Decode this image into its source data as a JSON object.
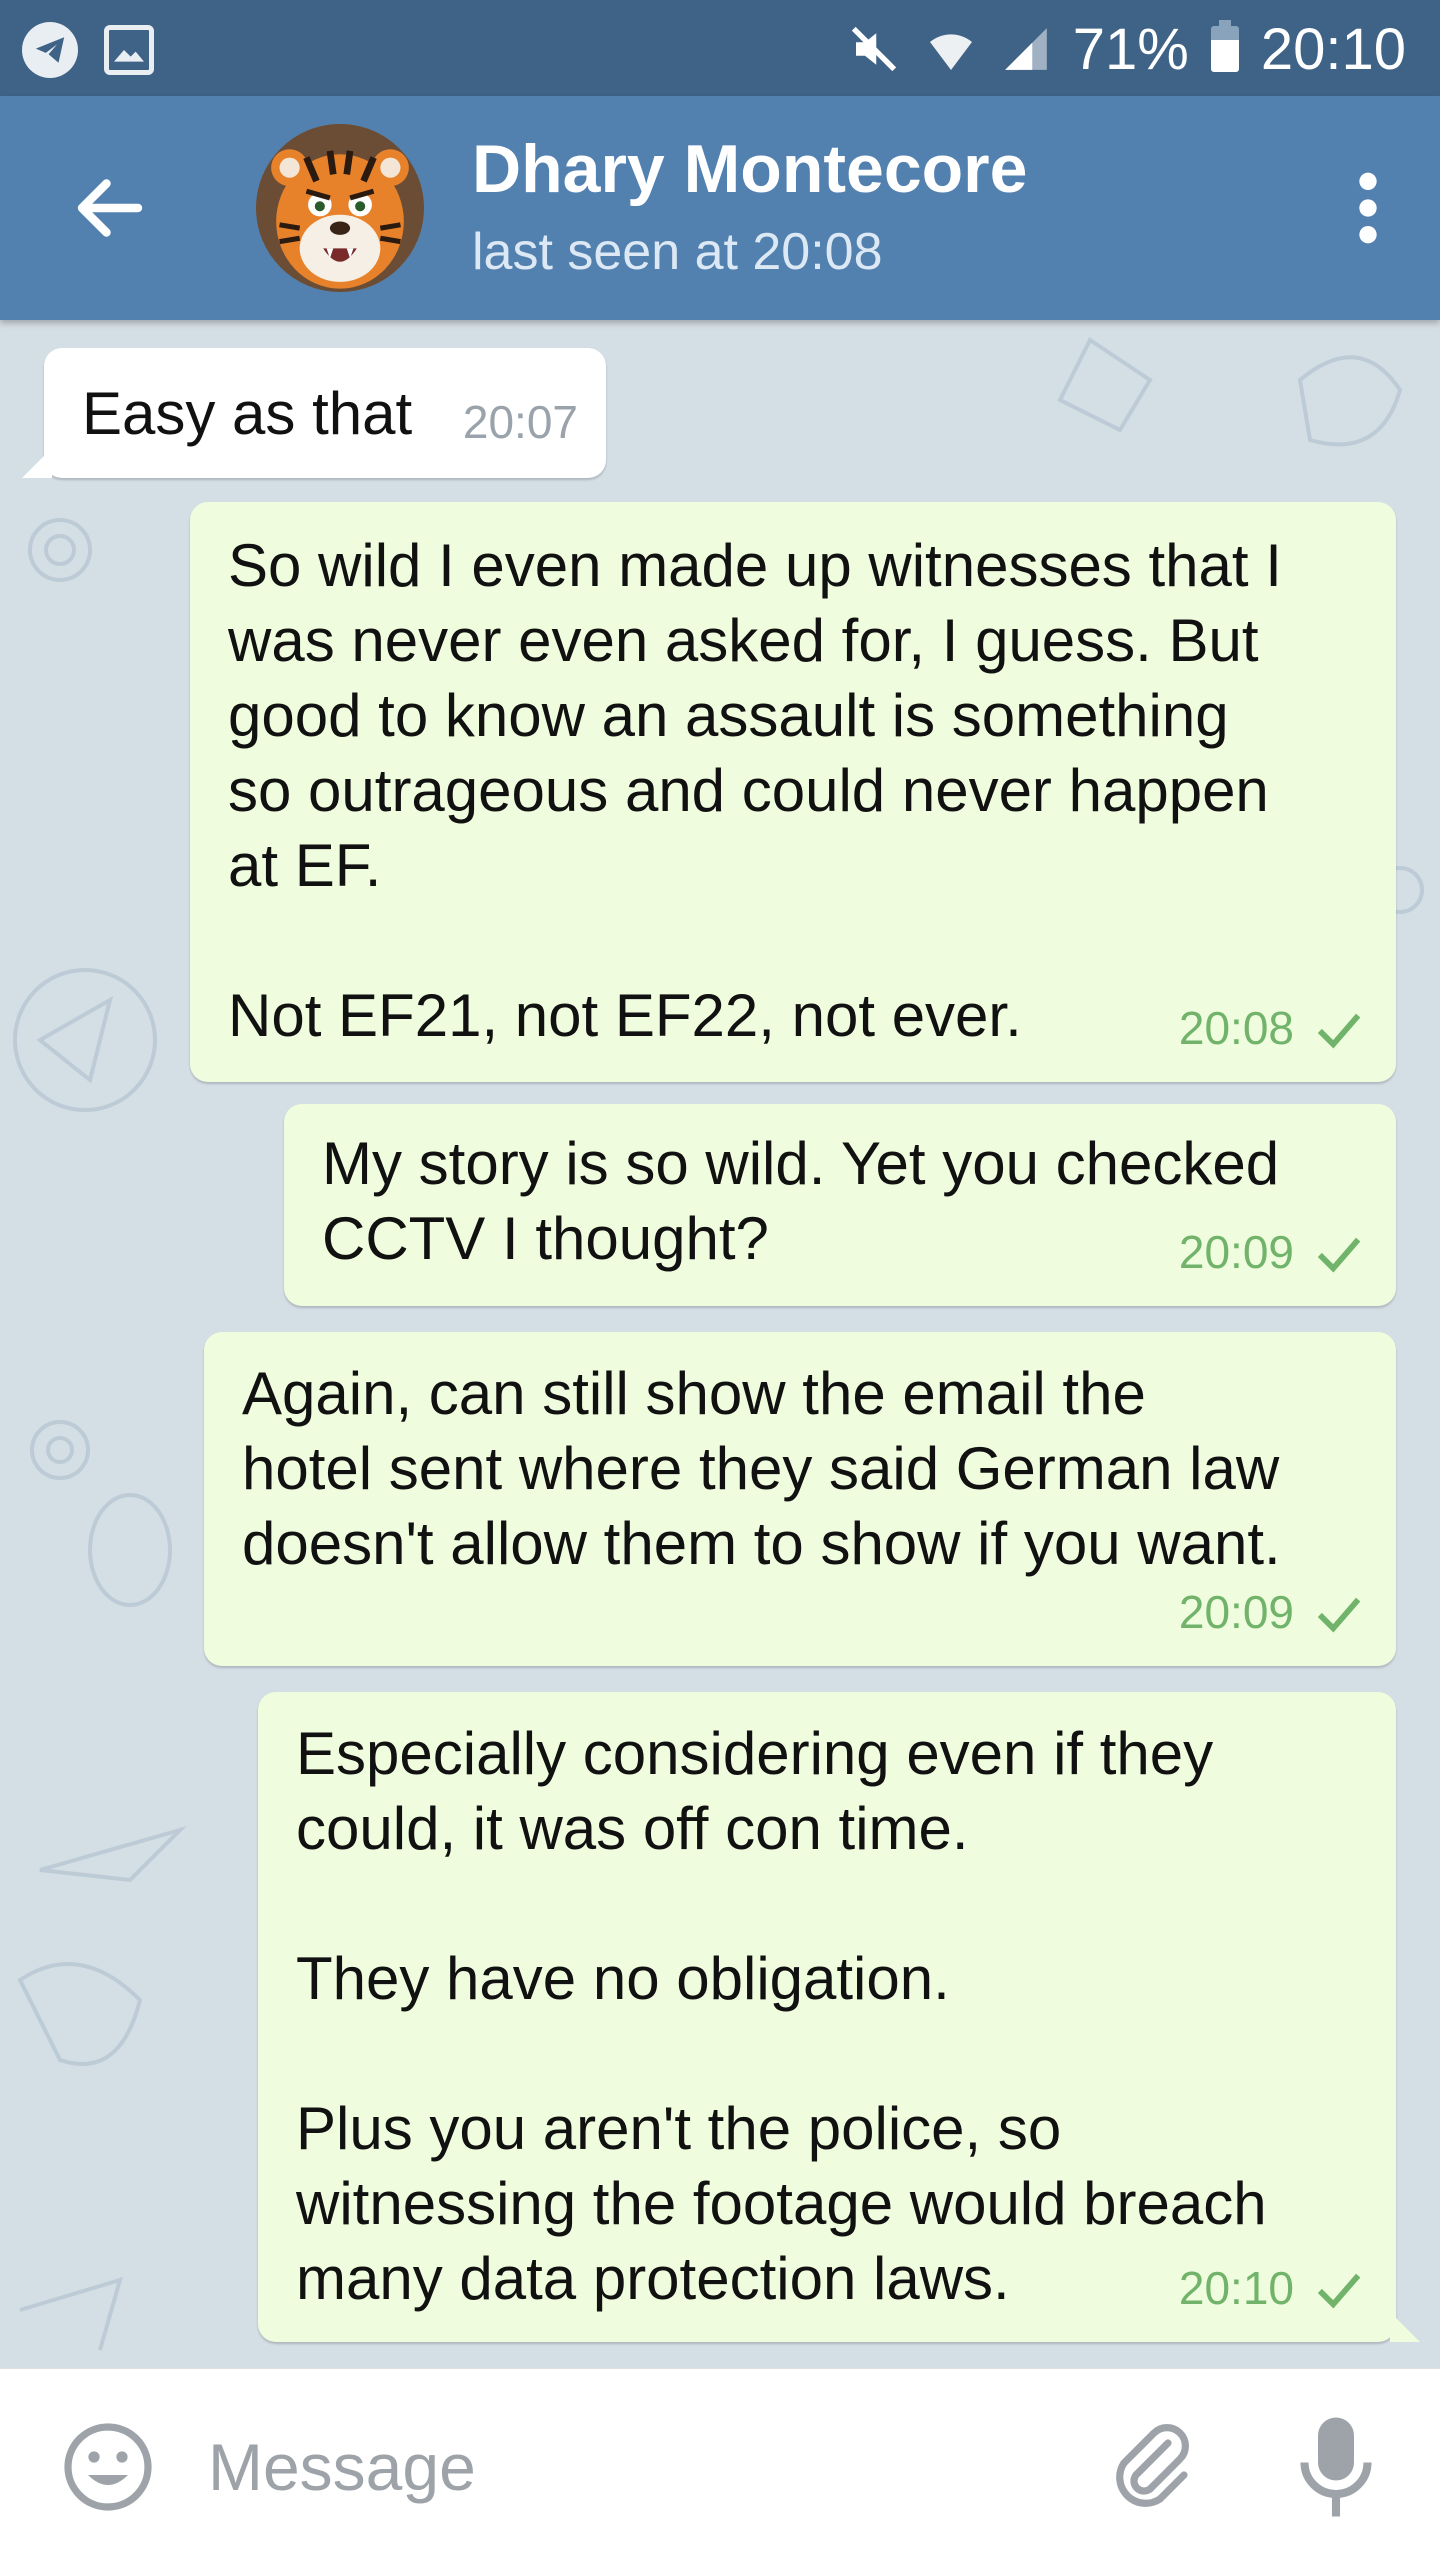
{
  "status_bar": {
    "battery": "71%",
    "time": "20:10",
    "icons": [
      "telegram-icon",
      "image-icon",
      "mute-icon",
      "wifi-icon",
      "signal-icon",
      "battery-icon"
    ]
  },
  "header": {
    "contact_name": "Dhary Montecore",
    "last_seen": "last seen at 20:08",
    "icons": [
      "back-arrow-icon",
      "tiger-avatar",
      "more-vert-icon"
    ]
  },
  "messages": [
    {
      "direction": "incoming",
      "text": "Easy as that",
      "time": "20:07"
    },
    {
      "direction": "outgoing",
      "text": "So wild I even made up witnesses that I\nwas never even asked for, I guess. But\ngood to know an assault is something\nso outrageous and could never happen\nat EF.\n\nNot EF21, not EF22, not ever.",
      "time": "20:08",
      "status": "sent"
    },
    {
      "direction": "outgoing",
      "text": "My story is so wild. Yet you checked\nCCTV I thought?",
      "time": "20:09",
      "status": "sent"
    },
    {
      "direction": "outgoing",
      "text": "Again, can still show the email the\nhotel sent where they said German law\ndoesn't allow them to show if you want.",
      "time": "20:09",
      "status": "sent"
    },
    {
      "direction": "outgoing",
      "text": "Especially considering even if they\ncould, it was off con time.\n\nThey have no obligation.\n\nPlus you aren't the police, so\nwitnessing the footage would breach\nmany data protection laws.",
      "time": "20:10",
      "status": "sent"
    }
  ],
  "composer": {
    "placeholder": "Message",
    "icons": [
      "emoji-icon",
      "attach-icon",
      "mic-icon"
    ]
  },
  "colors": {
    "status_bar": "#3f6386",
    "header": "#5281b0",
    "chat_background": "#d4dee5",
    "outgoing_bubble": "#effdde",
    "incoming_bubble": "#ffffff",
    "check_color": "#71b36a"
  }
}
